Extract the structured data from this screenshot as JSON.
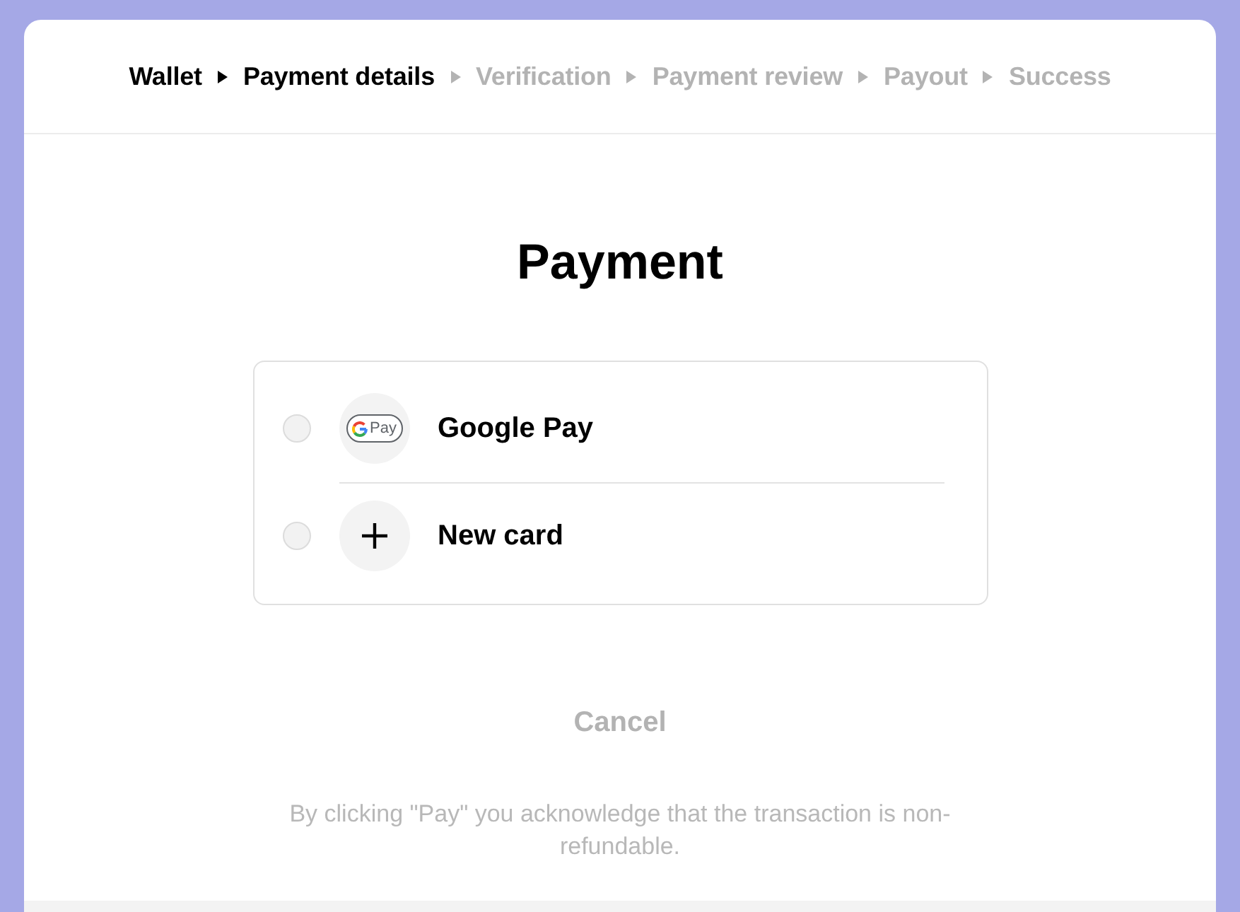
{
  "steps": [
    {
      "label": "Wallet",
      "reached": true
    },
    {
      "label": "Payment details",
      "reached": true
    },
    {
      "label": "Verification",
      "reached": false
    },
    {
      "label": "Payment review",
      "reached": false
    },
    {
      "label": "Payout",
      "reached": false
    },
    {
      "label": "Success",
      "reached": false
    }
  ],
  "title": "Payment",
  "methods": [
    {
      "kind": "google_pay",
      "label": "Google Pay",
      "logo_text": "Pay",
      "selected": false
    },
    {
      "kind": "new_card",
      "label": "New card",
      "selected": false
    }
  ],
  "cancel": "Cancel",
  "disclaimer": "By clicking \"Pay\" you acknowledge that the transaction is non-refundable."
}
